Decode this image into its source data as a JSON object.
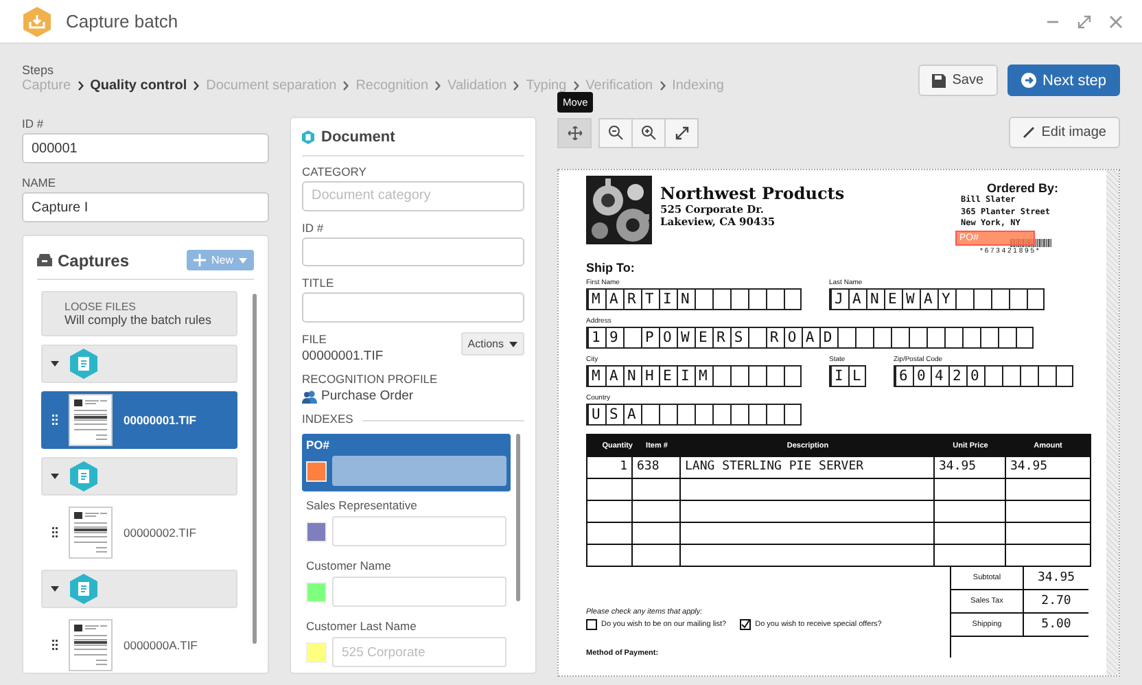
{
  "window": {
    "title": "Capture batch"
  },
  "steps": {
    "label": "Steps",
    "items": [
      {
        "label": "Capture",
        "selected": false
      },
      {
        "label": "Quality control",
        "selected": true
      },
      {
        "label": "Document separation",
        "selected": false
      },
      {
        "label": "Recognition",
        "selected": false
      },
      {
        "label": "Validation",
        "selected": false
      },
      {
        "label": "Typing",
        "selected": false
      },
      {
        "label": "Verification",
        "selected": false
      },
      {
        "label": "Indexing",
        "selected": false
      }
    ]
  },
  "actions": {
    "save": "Save",
    "next": "Next step",
    "edit_image": "Edit image",
    "tooltip": "Move"
  },
  "batch": {
    "id_label": "ID #",
    "id_value": "000001",
    "name_label": "NAME",
    "name_value": "Capture I"
  },
  "captures": {
    "title": "Captures",
    "new_button": "New",
    "loose_title": "LOOSE FILES",
    "loose_subtitle": "Will comply the batch rules",
    "groups": [
      {
        "expanded": true,
        "files": [
          {
            "name": "00000001.TIF",
            "selected": true
          }
        ]
      },
      {
        "expanded": true,
        "files": [
          {
            "name": "00000002.TIF",
            "selected": false
          }
        ]
      },
      {
        "expanded": true,
        "files": [
          {
            "name": "0000000A.TIF",
            "selected": false
          }
        ]
      }
    ]
  },
  "document": {
    "title": "Document",
    "category_label": "CATEGORY",
    "category_placeholder": "Document category",
    "id_label": "ID #",
    "title_label": "TITLE",
    "file_label": "FILE",
    "file_value": "00000001.TIF",
    "actions_button": "Actions",
    "profile_label": "RECOGNITION PROFILE",
    "profile_value": "Purchase Order",
    "indexes_label": "INDEXES",
    "indexes": [
      {
        "label": "PO#",
        "color": "#ff7f3f",
        "selected": true
      },
      {
        "label": "Sales Representative",
        "color": "#7f7fbf",
        "selected": false
      },
      {
        "label": "Customer Name",
        "color": "#7fff7f",
        "selected": false
      },
      {
        "label": "Customer Last Name",
        "color": "#ffff7f",
        "selected": false,
        "placeholder": "525 Corporate"
      }
    ]
  },
  "form": {
    "company": "Northwest Products",
    "company_address": [
      "525 Corporate Dr.",
      "Lakeview, CA  90435"
    ],
    "ordered_by_label": "Ordered By:",
    "ordered_by": [
      "Bill Slater",
      "365 Planter Street",
      "New York, NY"
    ],
    "overlay_label": "PO#",
    "barcode_text": "* 6 7 3 4 2 1 8 9 5 *",
    "ship_to": "Ship To:",
    "field_rows": [
      [
        {
          "label": "First Name",
          "value": "MARTIN"
        },
        {
          "label": "Last Name",
          "value": "JANEWAY"
        }
      ],
      [
        {
          "label": "Address",
          "value": "19 POWERS ROAD"
        }
      ],
      [
        {
          "label": "City",
          "value": "MANHEIM"
        },
        {
          "label": "State",
          "value": "IL"
        },
        {
          "label": "Zip/Postal Code",
          "value": "60420"
        }
      ],
      [
        {
          "label": "Country",
          "value": "USA"
        }
      ]
    ],
    "table_columns": [
      "Quantity",
      "Item #",
      "Description",
      "Unit Price",
      "Amount"
    ],
    "table_rows": [
      [
        "1",
        "638",
        "LANG STERLING PIE SERVER",
        "34.95",
        "34.95"
      ]
    ],
    "check_prompt": "Please check any items that apply:",
    "checks": [
      {
        "label": "Do you wish to be on our mailing list?",
        "checked": false
      },
      {
        "label": "Do you wish to receive special offers?",
        "checked": true
      }
    ],
    "totals": [
      {
        "label": "Subtotal",
        "value": "34.95"
      },
      {
        "label": "Sales Tax",
        "value": "2.70"
      },
      {
        "label": "Shipping",
        "value": "5.00"
      }
    ],
    "payment_label": "Method of Payment:"
  }
}
